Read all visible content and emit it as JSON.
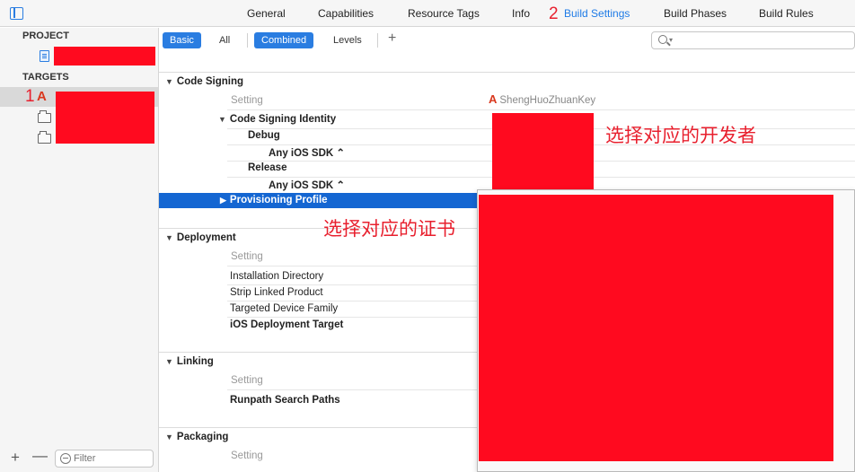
{
  "topbar": {
    "tabs": [
      {
        "label": "General"
      },
      {
        "label": "Capabilities"
      },
      {
        "label": "Resource Tags"
      },
      {
        "label": "Info"
      },
      {
        "label": "Build Settings"
      },
      {
        "label": "Build Phases"
      },
      {
        "label": "Build Rules"
      }
    ],
    "step_labels": [
      "1",
      "2"
    ]
  },
  "sidebar": {
    "project_header": "PROJECT",
    "targets_header": "TARGETS",
    "filter_placeholder": "Filter",
    "add_label": "+",
    "remove_label": "—"
  },
  "toolbar": {
    "basic": "Basic",
    "all": "All",
    "combined": "Combined",
    "levels": "Levels",
    "add": "+"
  },
  "sections": {
    "code_signing": {
      "title": "Code Signing",
      "setting_col": "Setting",
      "target_col": "ShengHuoZhuanKey",
      "identity": "Code Signing Identity",
      "debug": "Debug",
      "debug_sdk": "Any iOS SDK ⌃",
      "release": "Release",
      "release_sdk": "Any iOS SDK ⌃",
      "provisioning": "Provisioning Profile"
    },
    "deployment": {
      "title": "Deployment",
      "setting_col": "Setting",
      "rows": [
        "Installation Directory",
        "Strip Linked Product",
        "Targeted Device Family",
        "iOS Deployment Target"
      ]
    },
    "linking": {
      "title": "Linking",
      "setting_col": "Setting",
      "rows": [
        "Runpath Search Paths"
      ]
    },
    "packaging": {
      "title": "Packaging",
      "setting_col": "Setting"
    }
  },
  "annotations": {
    "developer": "选择对应的开发者",
    "certificate": "选择对应的证书"
  },
  "colors": {
    "accent": "#2a7de1",
    "selection": "#1466d2",
    "annotation_red": "#e8202e",
    "redaction": "#ff0a1f"
  }
}
